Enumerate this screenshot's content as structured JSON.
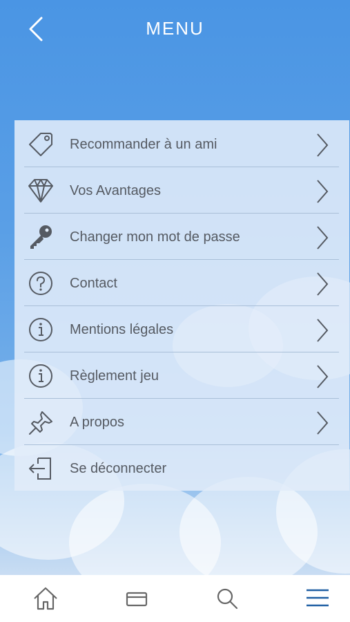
{
  "header": {
    "title": "MENU",
    "back_icon": "chevron-left-icon"
  },
  "menu": {
    "items": [
      {
        "label": "Recommander à un ami",
        "icon": "tag-icon"
      },
      {
        "label": "Vos Avantages",
        "icon": "diamond-icon"
      },
      {
        "label": "Changer mon mot de passe",
        "icon": "key-icon"
      },
      {
        "label": "Contact",
        "icon": "question-circle-icon"
      },
      {
        "label": "Mentions légales",
        "icon": "info-circle-icon"
      },
      {
        "label": "Règlement jeu",
        "icon": "info-circle-icon"
      },
      {
        "label": "A propos",
        "icon": "pin-icon"
      },
      {
        "label": "Se déconnecter",
        "icon": "logout-icon"
      }
    ]
  },
  "tabbar": {
    "tabs": [
      {
        "icon": "home-icon",
        "active": false
      },
      {
        "icon": "card-icon",
        "active": false
      },
      {
        "icon": "search-icon",
        "active": false
      },
      {
        "icon": "hamburger-menu-icon",
        "active": true
      }
    ]
  },
  "colors": {
    "sky": "#4a95e4",
    "active_tab": "#1f5fa3",
    "icon": "#555a62",
    "divider": "#a9bfd8"
  }
}
